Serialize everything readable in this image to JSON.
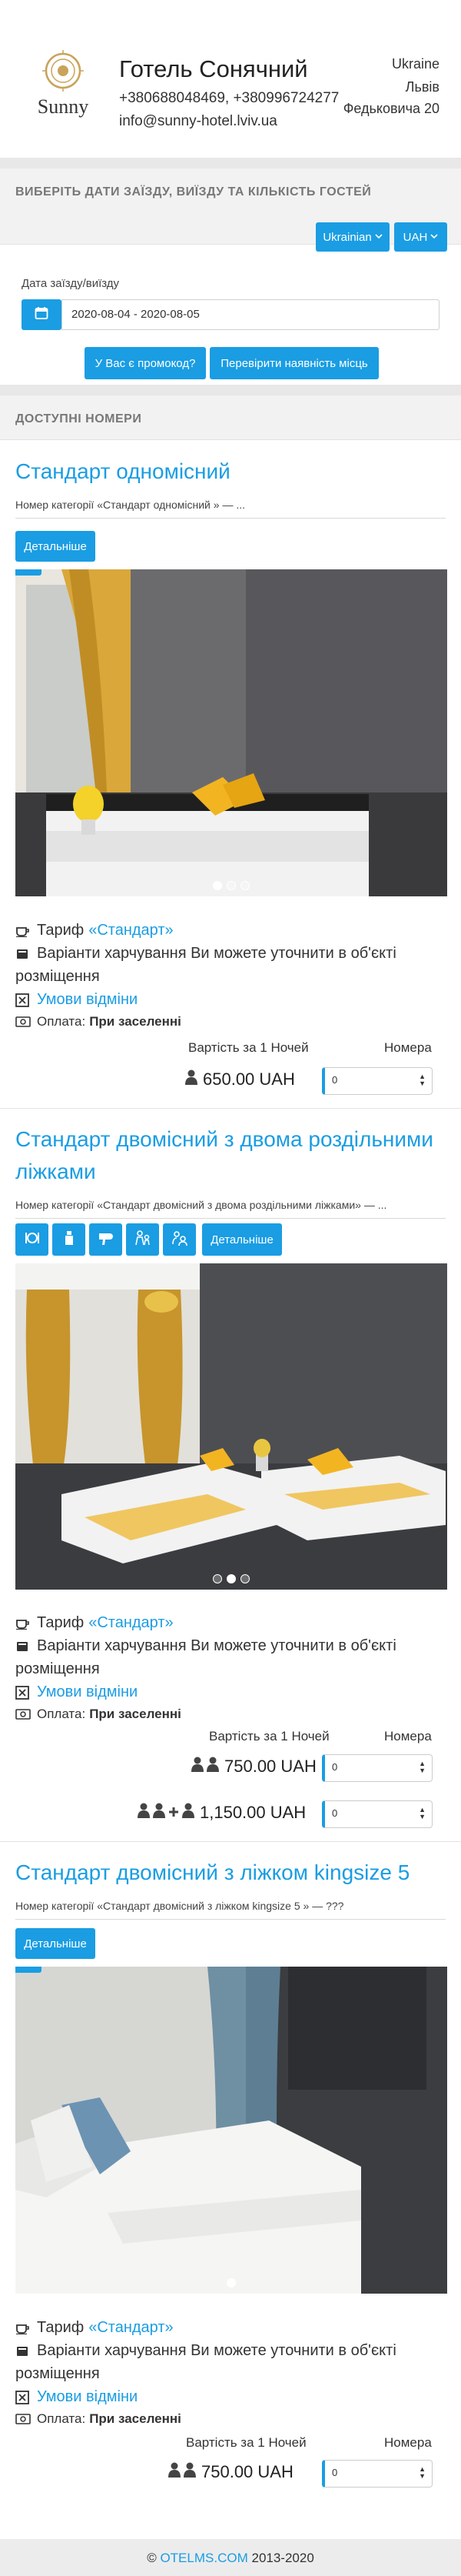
{
  "hotel": {
    "name": "Готель Сонячний",
    "phones": "+380688048469, +380996724277",
    "email": "info@sunny-hotel.lviv.ua",
    "country": "Ukraine",
    "city": "Львів",
    "street": "Федьковича 20",
    "logo_text": "Sunny"
  },
  "booking": {
    "section_title": "ВИБЕРІТЬ ДАТИ ЗАЇЗДУ, ВИЇЗДУ ТА КІЛЬКІСТЬ ГОСТЕЙ",
    "language": "Ukrainian",
    "currency": "UAH",
    "dates_label": "Дата заїзду/виїзду",
    "dates_value": "2020-08-04 - 2020-08-05",
    "promo_button": "У Вас є промокод?",
    "check_button": "Перевірити наявність місць"
  },
  "available_title": "ДОСТУПНІ НОМЕРИ",
  "common": {
    "details": "Детальніше",
    "tariff_prefix": "Тариф",
    "tariff_name": "«Стандарт»",
    "meal_line1": "Варіанти харчування Ви можете уточнити в об'єкті",
    "meal_line2": "розміщення",
    "cancel_link": "Умови відміни",
    "payment_label": "Оплата:",
    "payment_value": "При заселенні",
    "price_caption": "Вартість за 1 Ночей",
    "rooms_caption": "Номера",
    "select_value": "0"
  },
  "rooms": [
    {
      "title": "Стандарт одномісний",
      "description": "Номер категорії «Стандарт одномісний » — ...",
      "prices": [
        "650.00 UAH"
      ]
    },
    {
      "title_line1": "Стандарт двомісний з двома роздільними",
      "title_line2": "ліжками",
      "description": "Номер категорії «Стандарт двомісний з двома роздільними ліжками» — ...",
      "prices": [
        "750.00 UAH",
        "1,150.00 UAH"
      ]
    },
    {
      "title": "Стандарт двомісний з ліжком kingsize 5",
      "description": "Номер категорії «Стандарт двомісний з ліжком kingsize 5 » — ???",
      "prices": [
        "750.00 UAH"
      ]
    }
  ],
  "footer": {
    "copyright": "©",
    "link": "OTELMS.COM",
    "years": "2013-2020"
  },
  "colors": {
    "accent": "#1a9de3",
    "band": "#e8e8e8"
  },
  "icons": [
    "calendar-icon",
    "cup-icon",
    "cutlery-icon",
    "close-box-icon",
    "money-icon",
    "guest-icon",
    "plus-icon",
    "restaurant-icon",
    "bar-icon",
    "hairdryer-icon",
    "kids-icon",
    "couple-icon"
  ]
}
